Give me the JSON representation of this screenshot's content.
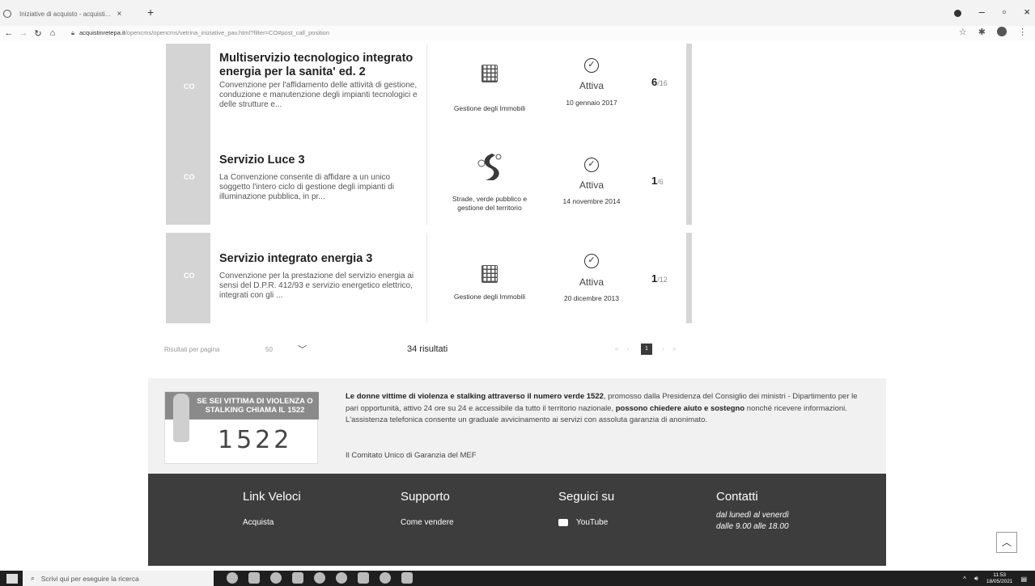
{
  "browser": {
    "tab_title": "Iniziative di acquisto - acquisti...",
    "tab_close": "×",
    "new_tab": "+",
    "url_domain": "acquistinretepa.it",
    "url_path": "/opencms/opencms/vetrina_iniziative_pav.html?filter=CO#post_call_position",
    "win_min": "–",
    "win_max": "▫",
    "win_close": "×"
  },
  "cards": [
    {
      "thumb": "CO",
      "title": "Multiservizio tecnologico integrato energia per la sanita' ed. 2",
      "desc": "Convenzione per l'affidamento delle attività di gestione, conduzione e manutenzione degli impianti tecnologici e delle strutture e...",
      "category": "Gestione degli Immobili",
      "category_icon": "building-icon",
      "status": "Attiva",
      "date": "10 gennaio 2017",
      "count_active": "6",
      "count_total": "/16"
    },
    {
      "thumb": "CO",
      "title": "Servizio Luce 3",
      "desc": "La Convenzione consente di affidare a un unico soggetto l'intero ciclo di gestione degli impianti di illuminazione pubblica, in pr...",
      "category": "Strade, verde pubblico e gestione del territorio",
      "category_icon": "road-icon",
      "status": "Attiva",
      "date": "14 novembre 2014",
      "count_active": "1",
      "count_total": "/6"
    },
    {
      "thumb": "CO",
      "title": "Servizio integrato energia 3",
      "desc": "Convenzione per la prestazione del servizio energia ai sensi del D.P.R. 412/93 e servizio energetico elettrico, integrati con gli ...",
      "category": "Gestione degli Immobili",
      "category_icon": "building-icon",
      "status": "Attiva",
      "date": "20 dicembre 2013",
      "count_active": "1",
      "count_total": "/12"
    }
  ],
  "pager": {
    "per_page_label": "Risultati per pagina",
    "per_page_value": "50",
    "results": "34 risultati",
    "prev": "« ‹",
    "current_page": "1",
    "next": "› »"
  },
  "banner": {
    "logo_line": "SE SEI VITTIMA DI VIOLENZA O STALKING CHIAMA IL 1522",
    "logo_number": "1522",
    "text_bold_1": "Le donne vittime di violenza e stalking attraverso il numero verde 1522",
    "text_1": ", promosso dalla Presidenza del Consiglio dei ministri - Dipartimento per le pari opportunità, attivo 24 ore su 24 e accessibile da tutto il territorio nazionale, ",
    "text_bold_2": "possono chiedere aiuto e sostegno",
    "text_2": " nonché ricevere informazioni. L'assistenza telefonica consente un graduale avvicinamento ai servizi con assoluta garanzia di anonimato.",
    "signature": "Il Comitato Unico di Garanzia del MEF"
  },
  "footer": {
    "col1_title": "Link Veloci",
    "col1_link": "Acquista",
    "col2_title": "Supporto",
    "col2_link": "Come vendere",
    "col3_title": "Seguici su",
    "col3_link": "YouTube",
    "col4_title": "Contatti",
    "col4_line1": "dal lunedì al venerdì",
    "col4_line2": "dalle 9.00 alle 18.00"
  },
  "taskbar": {
    "search_placeholder": "Scrivi qui per eseguire la ricerca",
    "time": "11:53",
    "date": "18/05/2021"
  }
}
